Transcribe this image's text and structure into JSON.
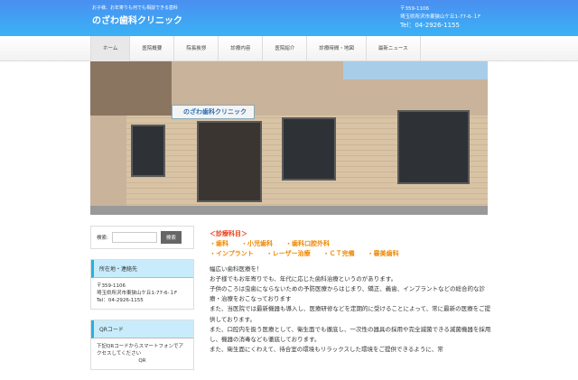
{
  "header": {
    "tagline": "お子様、お年寄りも何でも相談できる歯科",
    "logo": "のざわ歯科クリニック",
    "postal": "〒359-1106",
    "address": "埼玉県所沢市東狭山ケ丘1-77-6-１F",
    "tel": "Tel：04-2926-1155"
  },
  "nav": [
    "ホーム",
    "医院概要",
    "院長挨拶",
    "診療内容",
    "医院紹介",
    "診療時間・地図",
    "最新ニュース"
  ],
  "hero": {
    "sign": "のざわ歯科クリニック"
  },
  "sidebar": {
    "search_label": "検索:",
    "search_button": "検索",
    "location_title": "所在地・連絡先",
    "postal": "〒359-1106",
    "address": "埼玉県所沢市東狭山ケ丘1-77-6-１F",
    "tel": "Tel：04-2926-1155",
    "qr_title": "QRコード",
    "qr_text": "下記QRコードからスマートフォンでアクセスしてください",
    "qr_alt": "QR"
  },
  "main": {
    "heading": "＜診療科目＞",
    "row1": [
      "・歯科",
      "・小児歯科",
      "・歯科口腔外科"
    ],
    "row2": [
      "・インプラント",
      "・レーザー治療",
      "・ＣＴ完備",
      "・審美歯科"
    ],
    "paragraphs": [
      "幅広い歯科医療を！",
      "お子様でもお年寄りでも、年代に応じた歯科治療というのがあります。",
      "子供のころは虫歯にならないための予防医療からはじまり、矯正、義歯、インプラントなどの総合的な診療・治療をおこなっております",
      "また、当医院では最新機器も導入し、医療研修などを定期的に受けることによって、常に最新の医療をご提供しております。",
      "また、口腔内を扱う医療として、衛生面でも徹底し、一次性の器具の採用や完全滅菌できる滅菌機器を採用し、機器の消毒なども徹底しております。",
      "また、衛生面にくわえて、待合室の環境もリラックスした環境をご提供できるように、常"
    ]
  }
}
